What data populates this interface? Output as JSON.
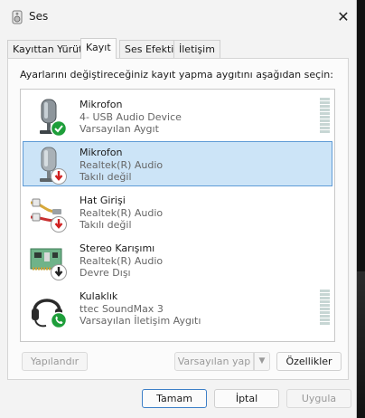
{
  "window": {
    "title": "Ses"
  },
  "tabs": [
    {
      "label": "Kayıttan Yürüt"
    },
    {
      "label": "Kayıt"
    },
    {
      "label": "Ses Efekti"
    },
    {
      "label": "İletişim"
    }
  ],
  "panel": {
    "instruction": "Ayarlarını değiştireceğiniz kayıt yapma aygıtını aşağıdan seçin:"
  },
  "devices": [
    {
      "name": "Mikrofon",
      "description": "4- USB Audio Device",
      "status": "Varsayılan Aygıt",
      "icon": "microphone-icon",
      "badge": "check-badge-icon"
    },
    {
      "name": "Mikrofon",
      "description": "Realtek(R) Audio",
      "status": "Takılı değil",
      "icon": "microphone-icon",
      "badge": "red-down-arrow-badge-icon"
    },
    {
      "name": "Hat Girişi",
      "description": "Realtek(R) Audio",
      "status": "Takılı değil",
      "icon": "line-in-cable-icon",
      "badge": "red-down-arrow-badge-icon"
    },
    {
      "name": "Stereo Karışımı",
      "description": "Realtek(R) Audio",
      "status": "Devre Dışı",
      "icon": "sound-card-icon",
      "badge": "black-down-arrow-badge-icon"
    },
    {
      "name": "Kulaklık",
      "description": "ttec SoundMax 3",
      "status": "Varsayılan İletişim Aygıtı",
      "icon": "headset-icon",
      "badge": "phone-badge-icon"
    }
  ],
  "buttons": {
    "configure": "Yapılandır",
    "set_default": "Varsayılan yap",
    "properties": "Özellikler",
    "ok": "Tamam",
    "cancel": "İptal",
    "apply": "Uygula"
  },
  "colors": {
    "selection": "#cce4f7",
    "selection_border": "#5f9bd6",
    "check_green": "#1e9e3a",
    "down_red": "#d02020",
    "primary_border": "#3c7fc7"
  }
}
